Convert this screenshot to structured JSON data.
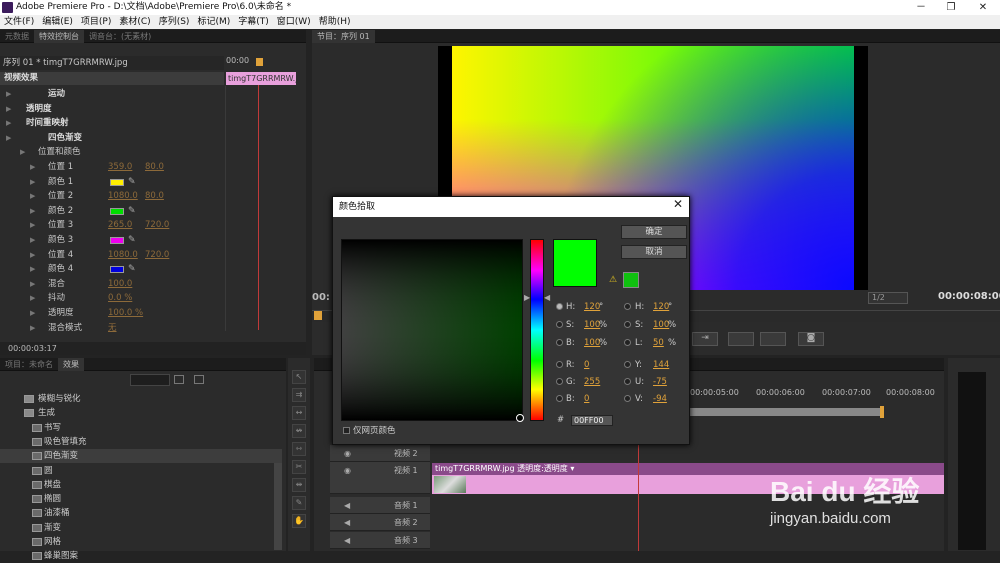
{
  "window": {
    "title": "Adobe Premiere Pro - D:\\文档\\Adobe\\Premiere Pro\\6.0\\未命名 *",
    "minimize": "－",
    "restore": "❐",
    "close": "✕"
  },
  "menu": [
    "文件(F)",
    "编辑(E)",
    "项目(P)",
    "素材(C)",
    "序列(S)",
    "标记(M)",
    "字幕(T)",
    "窗口(W)",
    "帮助(H)"
  ],
  "effect_controls": {
    "tabs": [
      "元数据",
      "特效控制台",
      "调音台：(无素材)"
    ],
    "seq_label": "序列 01 * timgT7GRRMRW.jpg",
    "time_start": "00:00",
    "clip": "timgT7GRRMRW.jpg",
    "section": "视频效果",
    "timecode": "00:00:03:17",
    "rows": [
      {
        "label": "运动",
        "bold": true
      },
      {
        "label": "透明度",
        "bold": true
      },
      {
        "label": "时间重映射",
        "bold": true
      },
      {
        "label": "四色渐变",
        "bold": true
      },
      {
        "label": "位置和颜色",
        "v1": "",
        "v2": ""
      },
      {
        "label": "位置 1",
        "v1": "359.0",
        "v2": "80.0"
      },
      {
        "label": "颜色 1",
        "color": "#ffee00"
      },
      {
        "label": "位置 2",
        "v1": "1080.0",
        "v2": "80.0"
      },
      {
        "label": "颜色 2",
        "color": "#00dd00"
      },
      {
        "label": "位置 3",
        "v1": "265.0",
        "v2": "720.0"
      },
      {
        "label": "颜色 3",
        "color": "#ee00ee"
      },
      {
        "label": "位置 4",
        "v1": "1080.0",
        "v2": "720.0"
      },
      {
        "label": "颜色 4",
        "color": "#0000dd"
      },
      {
        "label": "混合",
        "v1": "100.0"
      },
      {
        "label": "抖动",
        "v1": "0.0 %"
      },
      {
        "label": "透明度",
        "v1": "100.0 %"
      },
      {
        "label": "混合模式",
        "v1": "无"
      }
    ]
  },
  "program": {
    "title": "节目：序列 01",
    "timecode": "00:00:08:00",
    "zoom": "1/2",
    "left_tc": "00:"
  },
  "effects_panel": {
    "tabs": [
      "项目：未命名",
      "效果"
    ],
    "items": [
      {
        "label": "模糊与锐化",
        "kind": "folder"
      },
      {
        "label": "生成",
        "kind": "folder"
      },
      {
        "label": "书写",
        "kind": "fx"
      },
      {
        "label": "吸色管填充",
        "kind": "fx"
      },
      {
        "label": "四色渐变",
        "kind": "fx",
        "selected": true
      },
      {
        "label": "圆",
        "kind": "fx"
      },
      {
        "label": "棋盘",
        "kind": "fx"
      },
      {
        "label": "椭圆",
        "kind": "fx"
      },
      {
        "label": "油漆桶",
        "kind": "fx"
      },
      {
        "label": "渐变",
        "kind": "fx"
      },
      {
        "label": "网格",
        "kind": "fx"
      },
      {
        "label": "蜂巢图案",
        "kind": "fx"
      }
    ]
  },
  "timeline": {
    "ruler": [
      "00:00:05:00",
      "00:00:06:00",
      "00:00:07:00",
      "00:00:08:00"
    ],
    "tracks": [
      {
        "label": "视频 2"
      },
      {
        "label": "视频 1"
      },
      {
        "label": "音频 1"
      },
      {
        "label": "音频 2"
      },
      {
        "label": "音频 3"
      }
    ],
    "clip_label": "timgT7GRRMRW.jpg  透明度:透明度 ▾"
  },
  "dialog": {
    "title": "颜色拾取",
    "ok": "确定",
    "cancel": "取消",
    "web_only": "仅网页颜色",
    "hex_label": "#",
    "hex": "00FF00",
    "swatch": "#00ff00",
    "left_fields": [
      {
        "label": "H:",
        "value": "120",
        "unit": "°",
        "on": true
      },
      {
        "label": "S:",
        "value": "100",
        "unit": "%"
      },
      {
        "label": "B:",
        "value": "100",
        "unit": "%"
      },
      {
        "label": "R:",
        "value": "0",
        "unit": ""
      },
      {
        "label": "G:",
        "value": "255",
        "unit": ""
      },
      {
        "label": "B:",
        "value": "0",
        "unit": ""
      }
    ],
    "right_fields": [
      {
        "label": "H:",
        "value": "120",
        "unit": "°"
      },
      {
        "label": "S:",
        "value": "100",
        "unit": "%"
      },
      {
        "label": "L:",
        "value": "50",
        "unit": "%"
      },
      {
        "label": "Y:",
        "value": "144",
        "unit": ""
      },
      {
        "label": "U:",
        "value": "-75",
        "unit": ""
      },
      {
        "label": "V:",
        "value": "-94",
        "unit": ""
      }
    ]
  },
  "watermark": {
    "brand": "Bai du 经验",
    "url": "jingyan.baidu.com"
  },
  "colors": {
    "accent": "#e0a23a",
    "playhead": "#c03a3a",
    "clip_pink": "#e8a0dc"
  }
}
